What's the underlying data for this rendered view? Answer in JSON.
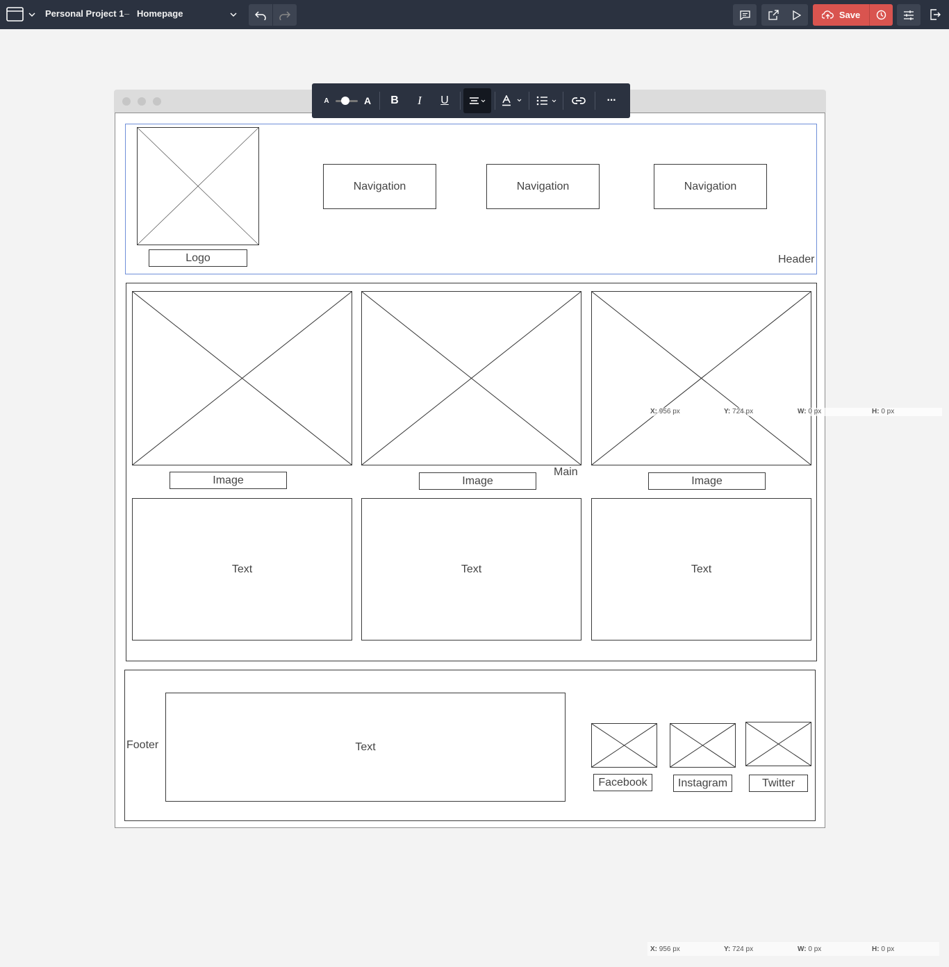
{
  "topbar": {
    "project": "Personal Project 1",
    "separator": "–",
    "page": "Homepage",
    "save_label": "Save"
  },
  "text_toolbar": {
    "small_a": "A",
    "large_a": "A",
    "bold": "B",
    "italic": "I",
    "underline": "U",
    "more": "···"
  },
  "header": {
    "label": "Header",
    "logo_label": "Logo",
    "nav": [
      "Navigation",
      "Navigation",
      "Navigation"
    ]
  },
  "main": {
    "label": "Main",
    "image_labels": [
      "Image",
      "Image",
      "Image"
    ],
    "text_blocks": [
      "Text",
      "Text",
      "Text"
    ]
  },
  "footer": {
    "label": "Footer",
    "text": "Text",
    "social": [
      "Facebook",
      "Instagram",
      "Twitter"
    ]
  },
  "coords_readout": {
    "x_label": "X:",
    "x_value": "956 px",
    "y_label": "Y:",
    "y_value": "724 px",
    "w_label": "W:",
    "w_value": "0 px",
    "h_label": "H:",
    "h_value": "0 px"
  }
}
